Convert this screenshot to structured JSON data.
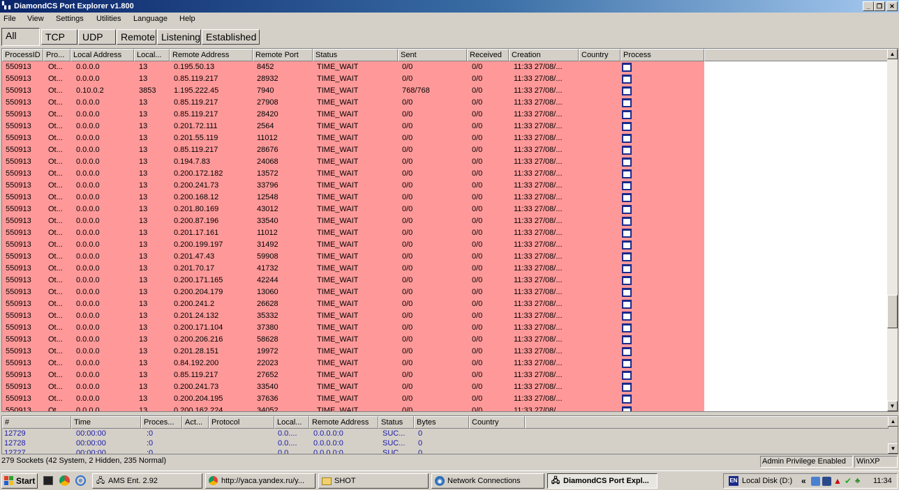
{
  "window": {
    "title": "DiamondCS Port Explorer v1.800",
    "icon": "network-app-icon"
  },
  "menu": [
    "File",
    "View",
    "Settings",
    "Utilities",
    "Language",
    "Help"
  ],
  "tabs": [
    "All",
    "TCP",
    "UDP",
    "Remote",
    "Listening",
    "Established"
  ],
  "grid": {
    "headers": [
      "ProcessID",
      "Pro...",
      "Local Address",
      "Local...",
      "Remote Address",
      "Remote Port",
      "Status",
      "Sent",
      "Received",
      "Creation",
      "Country",
      "Process"
    ],
    "rows": [
      [
        "550913",
        "Ot...",
        "0.0.0.0",
        "13",
        "0.195.50.13",
        "8452",
        "TIME_WAIT",
        "0/0",
        "0/0",
        "11:33 27/08/..."
      ],
      [
        "550913",
        "Ot...",
        "0.0.0.0",
        "13",
        "0.85.119.217",
        "28932",
        "TIME_WAIT",
        "0/0",
        "0/0",
        "11:33 27/08/..."
      ],
      [
        "550913",
        "Ot...",
        "0.10.0.2",
        "3853",
        "1.195.222.45",
        "7940",
        "TIME_WAIT",
        "768/768",
        "0/0",
        "11:33 27/08/..."
      ],
      [
        "550913",
        "Ot...",
        "0.0.0.0",
        "13",
        "0.85.119.217",
        "27908",
        "TIME_WAIT",
        "0/0",
        "0/0",
        "11:33 27/08/..."
      ],
      [
        "550913",
        "Ot...",
        "0.0.0.0",
        "13",
        "0.85.119.217",
        "28420",
        "TIME_WAIT",
        "0/0",
        "0/0",
        "11:33 27/08/..."
      ],
      [
        "550913",
        "Ot...",
        "0.0.0.0",
        "13",
        "0.201.72.111",
        "2564",
        "TIME_WAIT",
        "0/0",
        "0/0",
        "11:33 27/08/..."
      ],
      [
        "550913",
        "Ot...",
        "0.0.0.0",
        "13",
        "0.201.55.119",
        "11012",
        "TIME_WAIT",
        "0/0",
        "0/0",
        "11:33 27/08/..."
      ],
      [
        "550913",
        "Ot...",
        "0.0.0.0",
        "13",
        "0.85.119.217",
        "28676",
        "TIME_WAIT",
        "0/0",
        "0/0",
        "11:33 27/08/..."
      ],
      [
        "550913",
        "Ot...",
        "0.0.0.0",
        "13",
        "0.194.7.83",
        "24068",
        "TIME_WAIT",
        "0/0",
        "0/0",
        "11:33 27/08/..."
      ],
      [
        "550913",
        "Ot...",
        "0.0.0.0",
        "13",
        "0.200.172.182",
        "13572",
        "TIME_WAIT",
        "0/0",
        "0/0",
        "11:33 27/08/..."
      ],
      [
        "550913",
        "Ot...",
        "0.0.0.0",
        "13",
        "0.200.241.73",
        "33796",
        "TIME_WAIT",
        "0/0",
        "0/0",
        "11:33 27/08/..."
      ],
      [
        "550913",
        "Ot...",
        "0.0.0.0",
        "13",
        "0.200.168.12",
        "12548",
        "TIME_WAIT",
        "0/0",
        "0/0",
        "11:33 27/08/..."
      ],
      [
        "550913",
        "Ot...",
        "0.0.0.0",
        "13",
        "0.201.80.169",
        "43012",
        "TIME_WAIT",
        "0/0",
        "0/0",
        "11:33 27/08/..."
      ],
      [
        "550913",
        "Ot...",
        "0.0.0.0",
        "13",
        "0.200.87.196",
        "33540",
        "TIME_WAIT",
        "0/0",
        "0/0",
        "11:33 27/08/..."
      ],
      [
        "550913",
        "Ot...",
        "0.0.0.0",
        "13",
        "0.201.17.161",
        "11012",
        "TIME_WAIT",
        "0/0",
        "0/0",
        "11:33 27/08/..."
      ],
      [
        "550913",
        "Ot...",
        "0.0.0.0",
        "13",
        "0.200.199.197",
        "31492",
        "TIME_WAIT",
        "0/0",
        "0/0",
        "11:33 27/08/..."
      ],
      [
        "550913",
        "Ot...",
        "0.0.0.0",
        "13",
        "0.201.47.43",
        "59908",
        "TIME_WAIT",
        "0/0",
        "0/0",
        "11:33 27/08/..."
      ],
      [
        "550913",
        "Ot...",
        "0.0.0.0",
        "13",
        "0.201.70.17",
        "41732",
        "TIME_WAIT",
        "0/0",
        "0/0",
        "11:33 27/08/..."
      ],
      [
        "550913",
        "Ot...",
        "0.0.0.0",
        "13",
        "0.200.171.165",
        "42244",
        "TIME_WAIT",
        "0/0",
        "0/0",
        "11:33 27/08/..."
      ],
      [
        "550913",
        "Ot...",
        "0.0.0.0",
        "13",
        "0.200.204.179",
        "13060",
        "TIME_WAIT",
        "0/0",
        "0/0",
        "11:33 27/08/..."
      ],
      [
        "550913",
        "Ot...",
        "0.0.0.0",
        "13",
        "0.200.241.2",
        "26628",
        "TIME_WAIT",
        "0/0",
        "0/0",
        "11:33 27/08/..."
      ],
      [
        "550913",
        "Ot...",
        "0.0.0.0",
        "13",
        "0.201.24.132",
        "35332",
        "TIME_WAIT",
        "0/0",
        "0/0",
        "11:33 27/08/..."
      ],
      [
        "550913",
        "Ot...",
        "0.0.0.0",
        "13",
        "0.200.171.104",
        "37380",
        "TIME_WAIT",
        "0/0",
        "0/0",
        "11:33 27/08/..."
      ],
      [
        "550913",
        "Ot...",
        "0.0.0.0",
        "13",
        "0.200.206.216",
        "58628",
        "TIME_WAIT",
        "0/0",
        "0/0",
        "11:33 27/08/..."
      ],
      [
        "550913",
        "Ot...",
        "0.0.0.0",
        "13",
        "0.201.28.151",
        "19972",
        "TIME_WAIT",
        "0/0",
        "0/0",
        "11:33 27/08/..."
      ],
      [
        "550913",
        "Ot...",
        "0.0.0.0",
        "13",
        "0.84.192.200",
        "22023",
        "TIME_WAIT",
        "0/0",
        "0/0",
        "11:33 27/08/..."
      ],
      [
        "550913",
        "Ot...",
        "0.0.0.0",
        "13",
        "0.85.119.217",
        "27652",
        "TIME_WAIT",
        "0/0",
        "0/0",
        "11:33 27/08/..."
      ],
      [
        "550913",
        "Ot...",
        "0.0.0.0",
        "13",
        "0.200.241.73",
        "33540",
        "TIME_WAIT",
        "0/0",
        "0/0",
        "11:33 27/08/..."
      ],
      [
        "550913",
        "Ot...",
        "0.0.0.0",
        "13",
        "0.200.204.195",
        "37636",
        "TIME_WAIT",
        "0/0",
        "0/0",
        "11:33 27/08/..."
      ],
      [
        "550913",
        "Ot...",
        "0.0.0.0",
        "13",
        "0.200.162.224",
        "34052",
        "TIME_WAIT",
        "0/0",
        "0/0",
        "11:33 27/08/..."
      ]
    ],
    "row_color": "#ff9999"
  },
  "log": {
    "headers": [
      "#",
      "Time",
      "Proces...",
      "Act...",
      "Protocol",
      "Local...",
      "Remote Address",
      "Status",
      "Bytes",
      "Country"
    ],
    "rows": [
      [
        "12729",
        "00:00:00",
        ":0",
        "",
        "",
        "0.0....",
        "0.0.0.0:0",
        "SUC...",
        "0"
      ],
      [
        "12728",
        "00:00:00",
        ":0",
        "",
        "",
        "0.0....",
        "0.0.0.0:0",
        "SUC...",
        "0"
      ],
      [
        "12727",
        "00:00:00",
        ":0",
        "",
        "",
        "0.0....",
        "0.0.0.0:0",
        "SUC...",
        "0"
      ]
    ]
  },
  "status": {
    "sockets": "279 Sockets (42 System, 2 Hidden, 235 Normal)",
    "privilege": "Admin Privilege Enabled",
    "os": "WinXP"
  },
  "taskbar": {
    "start": "Start",
    "items": [
      {
        "label": "AMS Ent. 2.92",
        "icon": "app-icon"
      },
      {
        "label": "http://yaca.yandex.ru/y...",
        "icon": "chrome-icon"
      },
      {
        "label": "SHOT",
        "icon": "folder-icon"
      },
      {
        "label": "Network Connections",
        "icon": "network-icon"
      },
      {
        "label": "DiamondCS Port Expl...",
        "icon": "network-app-icon"
      }
    ],
    "lang": "EN",
    "disk": "Local Disk (D:)",
    "clock": "11:34"
  }
}
